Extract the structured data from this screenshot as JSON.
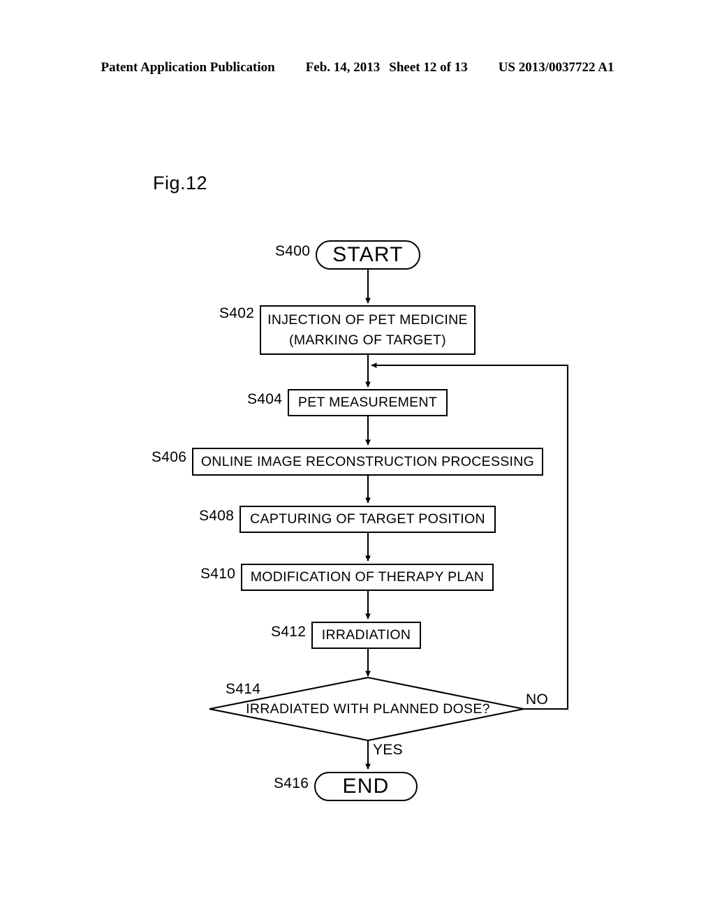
{
  "header": {
    "publication": "Patent Application Publication",
    "date": "Feb. 14, 2013",
    "sheet": "Sheet 12 of 13",
    "patent_number": "US 2013/0037722 A1"
  },
  "figure": {
    "label": "Fig.12"
  },
  "flowchart": {
    "nodes": [
      {
        "id": "S400",
        "tag": "S400",
        "shape": "terminator",
        "lines": [
          "START"
        ]
      },
      {
        "id": "S402",
        "tag": "S402",
        "shape": "process",
        "lines": [
          "INJECTION OF PET MEDICINE",
          "(MARKING OF TARGET)"
        ]
      },
      {
        "id": "S404",
        "tag": "S404",
        "shape": "process",
        "lines": [
          "PET MEASUREMENT"
        ]
      },
      {
        "id": "S406",
        "tag": "S406",
        "shape": "process",
        "lines": [
          "ONLINE IMAGE RECONSTRUCTION PROCESSING"
        ]
      },
      {
        "id": "S408",
        "tag": "S408",
        "shape": "process",
        "lines": [
          "CAPTURING OF TARGET POSITION"
        ]
      },
      {
        "id": "S410",
        "tag": "S410",
        "shape": "process",
        "lines": [
          "MODIFICATION OF THERAPY PLAN"
        ]
      },
      {
        "id": "S412",
        "tag": "S412",
        "shape": "process",
        "lines": [
          "IRRADIATION"
        ]
      },
      {
        "id": "S414",
        "tag": "S414",
        "shape": "decision",
        "lines": [
          "IRRADIATED WITH PLANNED DOSE?"
        ]
      },
      {
        "id": "S416",
        "tag": "S416",
        "shape": "terminator",
        "lines": [
          "END"
        ]
      }
    ],
    "branch_labels": {
      "no": "NO",
      "yes": "YES"
    }
  },
  "colors": {
    "ink": "#000000",
    "paper": "#ffffff"
  }
}
